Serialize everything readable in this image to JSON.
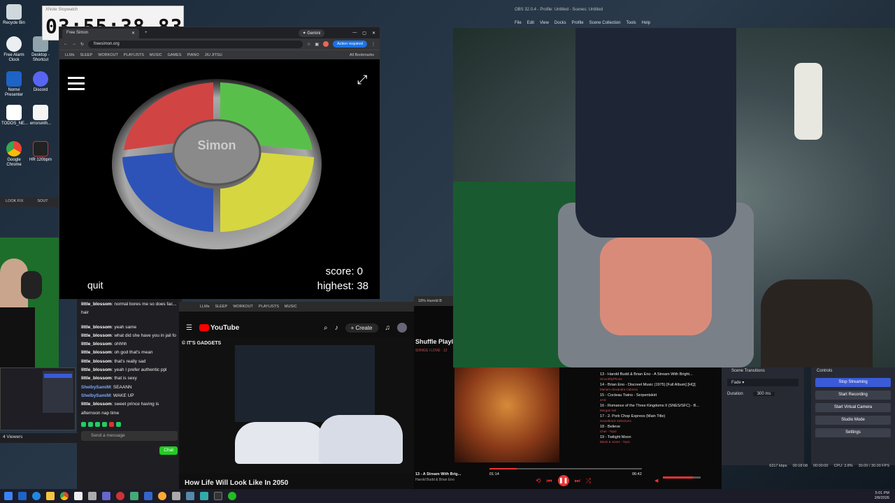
{
  "stopwatch": {
    "title": "XNote Stopwatch",
    "time": "03:55:38.83"
  },
  "browser": {
    "tab_title": "Free Simon",
    "gemini": "Gemini",
    "url": "freesimon.org",
    "action_required": "Action required",
    "bookmarks": [
      "LLMs",
      "SLEEP",
      "WORKOUT",
      "PLAYLISTS",
      "MUSIC",
      "GAMES",
      "PIANO",
      "JIU JITSU"
    ],
    "all_bookmarks": "All Bookmarks"
  },
  "simon": {
    "logo": "Simon",
    "quit": "quit",
    "score": "score: 0",
    "highest": "highest: 38"
  },
  "desktop_icons": [
    "Recycle Bin",
    "Free Alarm Clock",
    "Desktop - Shortcut",
    "Nomvi Presenter",
    "Discord",
    "TODOS_NE...",
    "errorsinth...",
    "Google Chrome",
    "HR 120bpm"
  ],
  "left_snippet": {
    "items": [
      "LOOK FIX",
      "SOUT"
    ]
  },
  "chat": {
    "messages": [
      {
        "user": "little_blossom",
        "text": "normal bores me so does fac... hair",
        "blue": false
      },
      {
        "user": "little_blossom",
        "text": "yeah same",
        "blue": false
      },
      {
        "user": "little_blossom",
        "text": "what did she have you in jail fo",
        "blue": false
      },
      {
        "user": "little_blossom",
        "text": "ohhhh",
        "blue": false
      },
      {
        "user": "little_blossom",
        "text": "oh god that's mean",
        "blue": false
      },
      {
        "user": "little_blossom",
        "text": "that's really sad",
        "blue": false
      },
      {
        "user": "little_blossom",
        "text": "yeah I prefer authentic ppl",
        "blue": false
      },
      {
        "user": "little_blossom",
        "text": "that is sexy",
        "blue": false
      },
      {
        "user": "ShelbySamiM",
        "text": "SEAANN",
        "blue": true
      },
      {
        "user": "ShelbySamiM",
        "text": "WAKE UP",
        "blue": true
      },
      {
        "user": "little_blossom",
        "text": "sweet prince having is afternoon nap time",
        "blue": false
      }
    ],
    "viewers": "4 Viewers",
    "send_placeholder": "Send a message",
    "chat_button": "Chat"
  },
  "youtube": {
    "logo": "YouTube",
    "create": "Create",
    "channel": "© IT'S GADGETS",
    "video_title": "How Life Will Look Like In 2050"
  },
  "music": {
    "tab_title": "18% Harold B",
    "playlist_title": "Shuffle Playl",
    "playlist_sub": "SONGS I LOVE · 12",
    "tracks": [
      {
        "title": "13 - Harold Budd & Brian Eno - A Stream With Bright...",
        "sub": "SmoothlyPhone"
      },
      {
        "title": "14 - Brian Eno - Discreet Music (1975) [Full Album] [HQ]",
        "sub": "Mariam Alexandra Cabrera"
      },
      {
        "title": "15 - Cocteau Twins - Serpentskirt",
        "sub": "4AD"
      },
      {
        "title": "16 - Romance of the Three Kingdoms II (SNES/SFC) - B...",
        "sub": "Morgan Nol"
      },
      {
        "title": "17 - 2. Pork Chop Express (Main Title)",
        "sub": "Soundtrack Selections"
      },
      {
        "title": "18 - Believe",
        "sub": "Cher - Topic"
      },
      {
        "title": "19 - Twilight Moon",
        "sub": "Blank & Jones - Topic"
      }
    ],
    "now_playing": "13 - A Stream With Brig...",
    "now_artist": "Harold Budd & Brian Eno",
    "elapsed": "01:14",
    "total": "06:42",
    "progress": 0.18,
    "volume": 0.8
  },
  "obs": {
    "title": "OBS 32.0.4 - Profile: Untitled - Scenes: Untitled",
    "menu": [
      "File",
      "Edit",
      "View",
      "Docks",
      "Profile",
      "Scene Collection",
      "Tools",
      "Help"
    ],
    "transitions_header": "Scene Transitions",
    "transition": "Fade",
    "duration_label": "Duration",
    "duration": "300 ms",
    "controls_header": "Controls",
    "buttons": [
      "Stop Streaming",
      "Start Recording",
      "Start Virtual Camera",
      "Studio Mode",
      "Settings"
    ],
    "status": [
      "6317 kbps",
      "00:18:08",
      "00:00:00",
      "CPU: 3.8%",
      "30.00 / 30.00 FPS"
    ]
  },
  "clock": {
    "time": "5:01 PM",
    "date": "2/8/2026"
  }
}
